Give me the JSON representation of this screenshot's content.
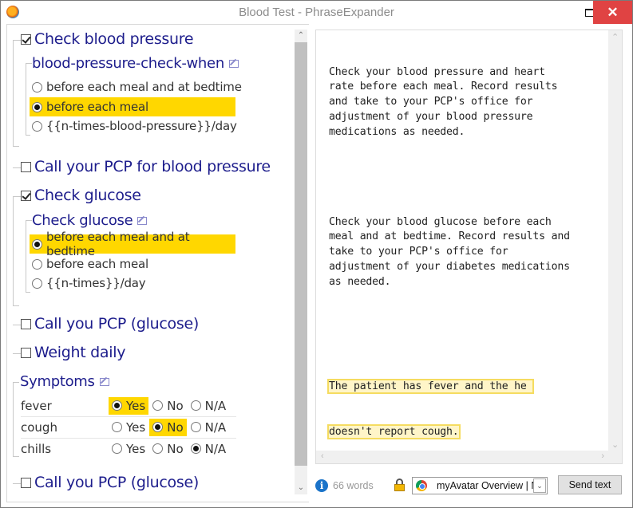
{
  "window": {
    "title": "Blood Test - PhraseExpander",
    "maximize_icon": "maximize-icon",
    "close_icon": "close-icon",
    "close_glyph": "✕"
  },
  "form": {
    "sections": [
      {
        "label": "Check blood pressure",
        "checked": true,
        "group": {
          "title": "blood-pressure-check-when",
          "options": [
            {
              "label": "before each meal and at bedtime",
              "selected": false
            },
            {
              "label": "before each meal",
              "selected": true
            },
            {
              "label": "{{n-times-blood-pressure}}/day",
              "selected": false
            }
          ]
        }
      },
      {
        "label": "Call your PCP for blood pressure",
        "checked": false
      },
      {
        "label": "Check glucose",
        "checked": true,
        "group": {
          "title": "Check glucose",
          "options": [
            {
              "label": "before each meal and at bedtime",
              "selected": true
            },
            {
              "label": "before each meal",
              "selected": false
            },
            {
              "label": "{{n-times}}/day",
              "selected": false
            }
          ]
        }
      },
      {
        "label": "Call you PCP (glucose)",
        "checked": false
      },
      {
        "label": "Weight daily",
        "checked": false
      }
    ],
    "symptoms": {
      "title": "Symptoms",
      "option_labels": [
        "Yes",
        "No",
        "N/A"
      ],
      "rows": [
        {
          "name": "fever",
          "selected": "Yes"
        },
        {
          "name": "cough",
          "selected": "No"
        },
        {
          "name": "chills",
          "selected": "N/A"
        }
      ]
    },
    "last_item": {
      "label": "Call you PCP (glucose)",
      "checked": false
    }
  },
  "preview": {
    "paragraph1": "Check your blood pressure and heart\nrate before each meal. Record results\nand take to your PCP's office for\nadjustment of your blood pressure\nmedications as needed.",
    "paragraph2": "Check your blood glucose before each\nmeal and at bedtime. Record results and\ntake to your PCP's office for\nadjustment of your diabetes medications\nas needed.",
    "highlighted_line1": "The patient has fever and the he ",
    "highlighted_line2": "doesn't report cough."
  },
  "footer": {
    "info_glyph": "i",
    "word_count": "66 words",
    "target_app": "myAvatar Overview | N",
    "dropdown_glyph": "⌄",
    "send_button": "Send text"
  },
  "colors": {
    "highlight": "#ffd700",
    "label_text": "#1d1d8c",
    "close_button": "#e04343"
  }
}
